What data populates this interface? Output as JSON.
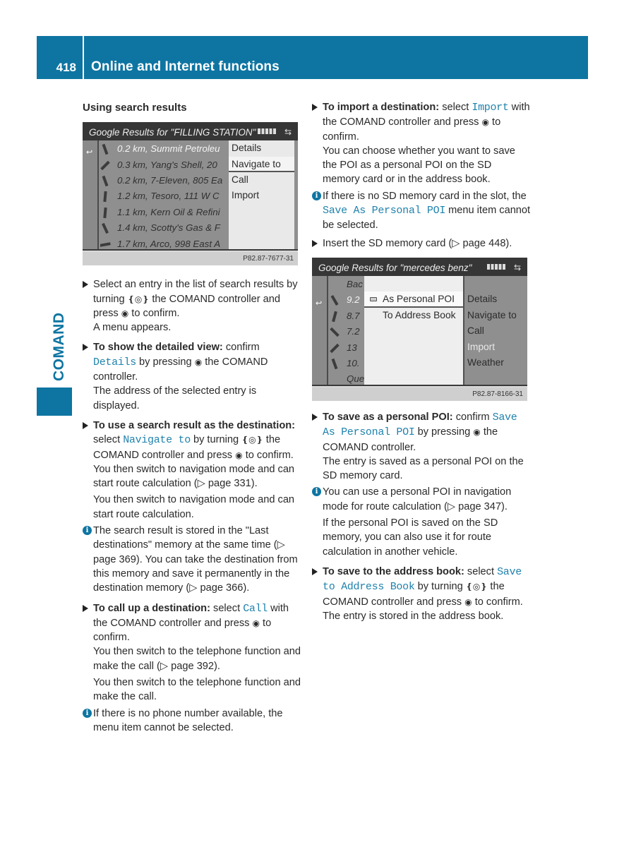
{
  "header": {
    "page_number": "418",
    "title": "Online and Internet functions"
  },
  "side_tab": {
    "label": "COMAND"
  },
  "left_column": {
    "section_title": "Using search results",
    "screenshot1": {
      "title": "Google Results for \"FILLING STATION\"",
      "back_icon": "back-arrow-icon",
      "rows": [
        "0.2 km, Summit Petroleu",
        "0.3 km, Yang's Shell, 20",
        "0.2 km, 7-Eleven, 805 Ea",
        "1.2 km, Tesoro, 111 W C",
        "1.1 km, Kern Oil & Refini",
        "1.4 km, Scotty's Gas & F",
        "1.7 km, Arco, 998 East A"
      ],
      "menu": [
        "Details",
        "Navigate to",
        "Call",
        "Import"
      ],
      "menu_selected": "Navigate to",
      "figure_id": "P82.87-7677-31"
    },
    "step1": {
      "text_a": "Select an entry in the list of search results by turning",
      "text_b": "the COMAND controller and press",
      "text_c": "to confirm.",
      "result": "A menu appears."
    },
    "step2": {
      "bold": "To show the detailed view:",
      "text_a": "confirm",
      "code": "Details",
      "text_b": "by pressing",
      "text_c": "the COMAND controller.",
      "result": "The address of the selected entry is displayed."
    },
    "step3": {
      "bold": "To use a search result as the destination:",
      "text_a": "select",
      "code": "Navigate to",
      "text_b": "by turning",
      "text_c": "the COMAND controller and press",
      "text_d": "to confirm.",
      "result1": "You then switch to navigation mode and can start route calculation (▷ page 331).",
      "result2": "You then switch to navigation mode and can start route calculation."
    },
    "note1": "The search result is stored in the \"Last destinations\" memory at the same time (▷ page 369). You can take the destination from this memory and save it permanently in the destination memory (▷ page 366).",
    "step4": {
      "bold": "To call up a destination:",
      "text_a": "select",
      "code": "Call",
      "text_b": "with the COMAND controller and press",
      "text_c": "to confirm.",
      "result1": "You then switch to the telephone function and make the call (▷ page 392).",
      "result2": "You then switch to the telephone function and make the call."
    },
    "note2": "If there is no phone number available, the menu item cannot be selected."
  },
  "right_column": {
    "step5": {
      "bold": "To import a destination:",
      "text_a": "select",
      "code": "Import",
      "text_b": "with the COMAND controller and press",
      "text_c": "to confirm.",
      "result": "You can choose whether you want to save the POI as a personal POI on the SD memory card or in the address book."
    },
    "note3": {
      "text_a": "If there is no SD memory card in the slot, the",
      "code": "Save As Personal POI",
      "text_b": "menu item cannot be selected."
    },
    "step6": "Insert the SD memory card (▷ page 448).",
    "screenshot2": {
      "title": "Google Results for \"mercedes benz\"",
      "rows": [
        "Bac",
        "9.2",
        "8.7",
        "7.2",
        "13",
        "10.",
        "Que"
      ],
      "submenu": [
        "As Personal POI",
        "To Address Book"
      ],
      "submenu_selected": "As Personal POI",
      "menu": [
        "Details",
        "Navigate to",
        "Call",
        "Import",
        "Weather"
      ],
      "menu_disabled": "Import",
      "figure_id": "P82.87-8166-31"
    },
    "step7": {
      "bold": "To save as a personal POI:",
      "text_a": "confirm",
      "code": "Save As Personal POI",
      "text_b": "by pressing",
      "text_c": "the COMAND controller.",
      "result": "The entry is saved as a personal POI on the SD memory card."
    },
    "note4": "You can use a personal POI in navigation mode for route calculation (▷ page 347).",
    "note4_cont": "If the personal POI is saved on the SD memory, you can also use it for route calculation in another vehicle.",
    "step8": {
      "bold": "To save to the address book:",
      "text_a": "select",
      "code": "Save to Address Book",
      "text_b": "by turning",
      "text_c": "the COMAND controller and press",
      "text_d": "to confirm.",
      "result": "The entry is stored in the address book."
    }
  },
  "icons": {
    "turn": "❴◎❵",
    "press": "◉",
    "info": "i"
  },
  "colors": {
    "brand_blue": "#0e75a2",
    "code_blue": "#1f82ad"
  }
}
